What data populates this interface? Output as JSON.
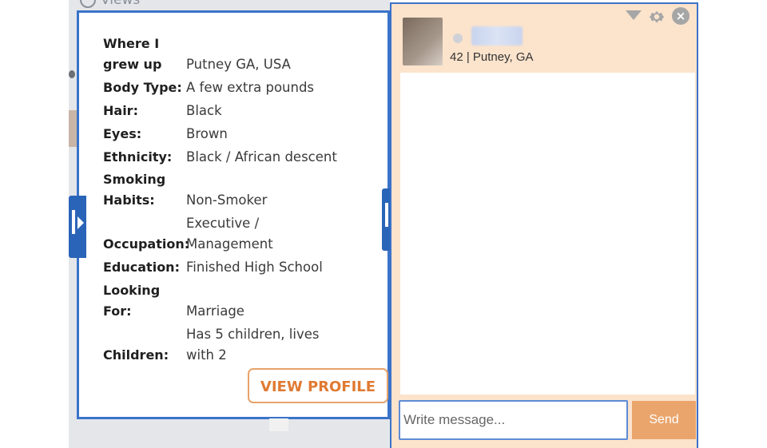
{
  "background": {
    "views_label": "Views"
  },
  "profile": {
    "fields": [
      {
        "label": "Where I grew up",
        "value": "Putney GA, USA"
      },
      {
        "label": "Body Type:",
        "value": "A few extra pounds"
      },
      {
        "label": "Hair:",
        "value": "Black"
      },
      {
        "label": "Eyes:",
        "value": "Brown"
      },
      {
        "label": "Ethnicity:",
        "value": "Black / African descent"
      },
      {
        "label": "Smoking Habits:",
        "value": "Non-Smoker"
      },
      {
        "label": "Occupation:",
        "value": "Executive / Management"
      },
      {
        "label": "Education:",
        "value": "Finished High School"
      },
      {
        "label": "Looking For:",
        "value": "Marriage"
      },
      {
        "label": "Children:",
        "value": "Has 5 children, lives with 2"
      }
    ],
    "view_profile_label": "VIEW PROFILE"
  },
  "chat": {
    "meta": "42 | Putney, GA",
    "input_placeholder": "Write message...",
    "send_label": "Send",
    "icons": [
      "dropdown-menu-icon",
      "gear-icon",
      "close-icon"
    ]
  }
}
